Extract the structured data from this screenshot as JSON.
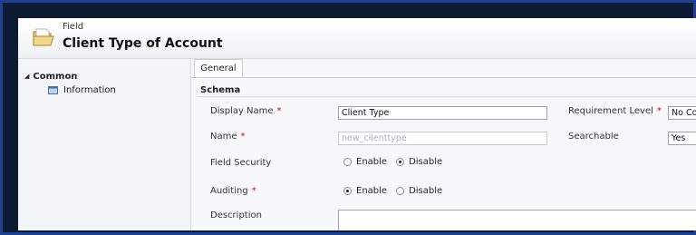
{
  "header": {
    "entity_type": "Field",
    "title": "Client Type of Account"
  },
  "nav": {
    "group_label": "Common",
    "items": [
      {
        "label": "Information"
      }
    ]
  },
  "tabs": [
    {
      "label": "General",
      "selected": true
    }
  ],
  "section": {
    "title": "Schema"
  },
  "form": {
    "display_name": {
      "label": "Display Name",
      "required": "*",
      "value": "Client Type"
    },
    "name": {
      "label": "Name",
      "required": "*",
      "value": "new_clienttype"
    },
    "field_security": {
      "label": "Field Security",
      "options": [
        "Enable",
        "Disable"
      ],
      "selected": "Disable"
    },
    "auditing": {
      "label": "Auditing",
      "required": "*",
      "options": [
        "Enable",
        "Disable"
      ],
      "selected": "Enable"
    },
    "description": {
      "label": "Description",
      "value": ""
    },
    "requirement_level": {
      "label": "Requirement Level",
      "required": "*",
      "value": "No Const"
    },
    "searchable": {
      "label": "Searchable",
      "value": "Yes"
    }
  },
  "colors": {
    "frame_border": "#1c3f8f",
    "required_star": "#dd0000"
  }
}
